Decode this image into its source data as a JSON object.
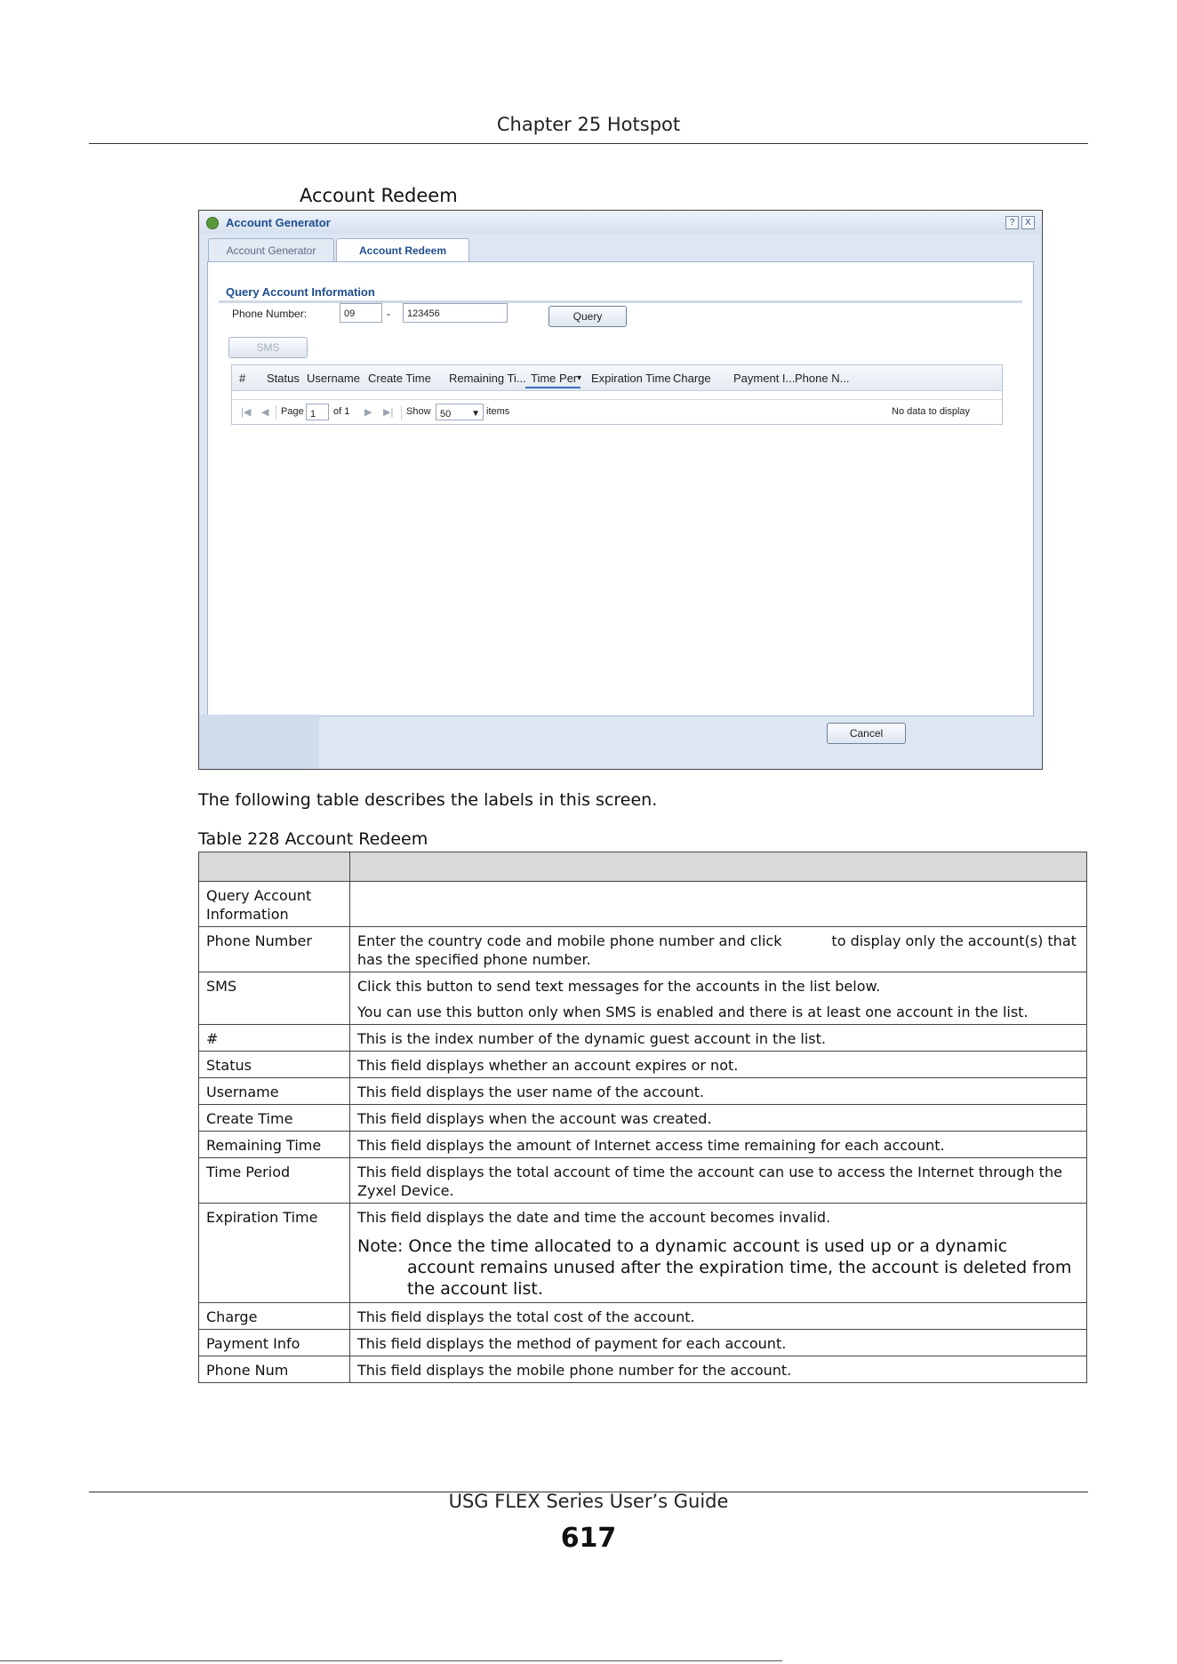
{
  "page": {
    "chapter": "Chapter 25 Hotspot",
    "figure_caption": "Account Redeem",
    "intro": "The following table describes the labels in this screen.",
    "table_caption": "Table 228   Account Redeem",
    "footer": "USG FLEX Series User’s Guide",
    "page_number": "617"
  },
  "screenshot": {
    "window_title": "Account Generator",
    "help": "?",
    "close": "X",
    "tabs": [
      "Account Generator",
      "Account Redeem"
    ],
    "section_title": "Query Account Information",
    "phone_label": "Phone Number:",
    "phone_cc": "09",
    "dash": "-",
    "phone_number": "123456",
    "query_btn": "Query",
    "sms_btn": "SMS",
    "columns": [
      "#",
      "Status",
      "Username",
      "Create Time",
      "Remaining Ti...",
      "Time Per",
      "Expiration Time",
      "Charge",
      "Payment I...",
      "Phone N..."
    ],
    "sort_arrow": "▾",
    "pager": {
      "first": "|◀",
      "prev": "◀",
      "page_label": "Page",
      "page": "1",
      "of": "of 1",
      "next": "▶",
      "last": "▶|",
      "show": "Show",
      "show_value": "50",
      "items": "items",
      "empty": "No data to display"
    },
    "cancel_btn": "Cancel"
  },
  "table": {
    "rows": [
      {
        "label": "Query Account Information",
        "desc": ""
      },
      {
        "label": "Phone Number",
        "desc": "Enter the country code and mobile phone number and click           to display only the account(s) that has the specified phone number."
      },
      {
        "label": "SMS",
        "desc": "Click this button to send text messages for the accounts in the list below.",
        "desc2": "You can use this button only when SMS is enabled and there is at least one account in the list."
      },
      {
        "label": "#",
        "desc": "This is the index number of the dynamic guest account in the list."
      },
      {
        "label": "Status",
        "desc": "This field displays whether an account expires or not."
      },
      {
        "label": "Username",
        "desc": "This field displays the user name of the account."
      },
      {
        "label": "Create Time",
        "desc": "This field displays when the account was created."
      },
      {
        "label": "Remaining Time",
        "desc": "This field displays the amount of Internet access time remaining for each account."
      },
      {
        "label": "Time Period",
        "desc": "This field displays the total account of time the account can use to access the Internet through the Zyxel Device."
      },
      {
        "label": "Expiration Time",
        "desc": "This field displays the date and time the account becomes invalid.",
        "note": "Note: Once the time allocated to a dynamic account is used up or a dynamic account remains unused after the expiration time, the account is deleted from the account list."
      },
      {
        "label": "Charge",
        "desc": "This field displays the total cost of the account."
      },
      {
        "label": "Payment Info",
        "desc": "This field displays the method of payment for each account."
      },
      {
        "label": "Phone Num",
        "desc": "This field displays the mobile phone number for the account."
      }
    ]
  }
}
